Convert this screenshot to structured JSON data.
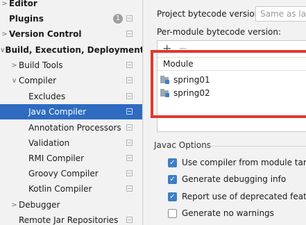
{
  "sidebar": {
    "items": [
      {
        "label": "Editor",
        "bold": true,
        "arrow": ">",
        "level": 0
      },
      {
        "label": "Plugins",
        "bold": true,
        "arrow": "",
        "level": 0,
        "badge": "1"
      },
      {
        "label": "Version Control",
        "bold": true,
        "arrow": ">",
        "level": 0
      },
      {
        "label": "Build, Execution, Deployment",
        "bold": true,
        "arrow": "∨",
        "level": 0
      },
      {
        "label": "Build Tools",
        "bold": false,
        "arrow": ">",
        "level": 1
      },
      {
        "label": "Compiler",
        "bold": false,
        "arrow": "∨",
        "level": 1
      },
      {
        "label": "Excludes",
        "bold": false,
        "arrow": "",
        "level": 2
      },
      {
        "label": "Java Compiler",
        "bold": false,
        "arrow": "",
        "level": 2,
        "selected": true
      },
      {
        "label": "Annotation Processors",
        "bold": false,
        "arrow": "",
        "level": 2
      },
      {
        "label": "Validation",
        "bold": false,
        "arrow": "",
        "level": 2
      },
      {
        "label": "RMI Compiler",
        "bold": false,
        "arrow": "",
        "level": 2
      },
      {
        "label": "Groovy Compiler",
        "bold": false,
        "arrow": "",
        "level": 2
      },
      {
        "label": "Kotlin Compiler",
        "bold": false,
        "arrow": "",
        "level": 2
      },
      {
        "label": "Debugger",
        "bold": false,
        "arrow": ">",
        "level": 1
      },
      {
        "label": "Remote Jar Repositories",
        "bold": false,
        "arrow": "",
        "level": 1
      }
    ]
  },
  "main": {
    "project_bytecode_label": "Project bytecode version:",
    "project_bytecode_value": "Same as lang",
    "per_module_label": "Per-module bytecode version:",
    "add_button": "+",
    "remove_button": "−",
    "module_column": "Module",
    "modules": [
      "spring01",
      "spring02"
    ],
    "javac_section": "Javac Options",
    "options": [
      {
        "label": "Use compiler from module target J",
        "checked": true
      },
      {
        "label": "Generate debugging info",
        "checked": true
      },
      {
        "label": "Report use of deprecated features",
        "checked": true
      },
      {
        "label": "Generate no warnings",
        "checked": false
      }
    ]
  },
  "colors": {
    "selection": "#2e6bc1",
    "highlight_border": "#e0392f",
    "checkbox": "#3d7ec5"
  }
}
